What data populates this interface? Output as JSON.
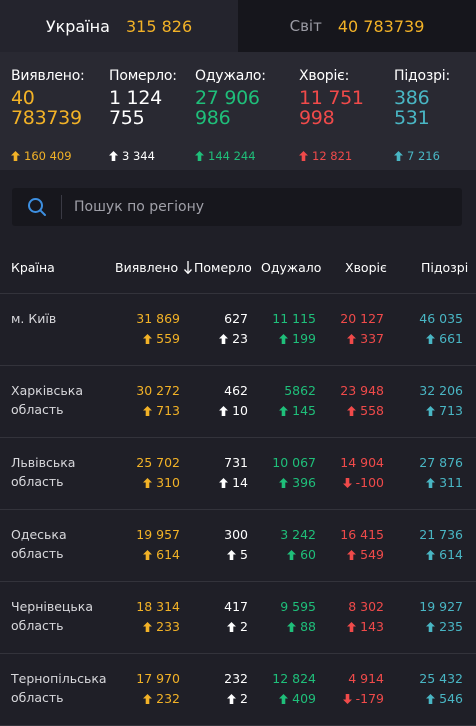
{
  "tabs": [
    {
      "name": "Україна",
      "value": "315 826"
    },
    {
      "name": "Світ",
      "value": "40 783739"
    }
  ],
  "summary": {
    "detected": {
      "label": "Виявлено:",
      "line1": "40",
      "line2": "783739",
      "delta": "160 409",
      "dir": "up",
      "color": "#f2b227"
    },
    "died": {
      "label": "Померло:",
      "line1": "1 124",
      "line2": "755",
      "delta": "3 344",
      "dir": "up",
      "color": "#ffffff"
    },
    "recovered": {
      "label": "Одужало:",
      "line1": "27 906",
      "line2": "986",
      "delta": "144 244",
      "dir": "up",
      "color": "#1fbf7a"
    },
    "sick": {
      "label": "Хворіє:",
      "line1": "11 751",
      "line2": "998",
      "delta": "12 821",
      "dir": "up",
      "color": "#f04a4a"
    },
    "suspected": {
      "label": "Підозрі:",
      "line1": "386",
      "line2": "531",
      "delta": "7 216",
      "dir": "up",
      "color": "#49b6c4"
    }
  },
  "search": {
    "placeholder": "Пошук по регіону"
  },
  "table": {
    "headers": {
      "country": "Країна",
      "detected": "Виявлено",
      "died": "Померло",
      "recovered": "Одужало",
      "sick": "Хворіє",
      "suspected": "Підозрі"
    },
    "rows": [
      {
        "name": "м. Київ",
        "detected": "31 869",
        "detected_d": "559",
        "detected_dir": "up",
        "died": "627",
        "died_d": "23",
        "died_dir": "up",
        "recovered": "11 115",
        "recovered_d": "199",
        "recovered_dir": "up",
        "sick": "20 127",
        "sick_d": "337",
        "sick_dir": "up",
        "suspected": "46 035",
        "suspected_d": "661",
        "suspected_dir": "up"
      },
      {
        "name": "Харківська область",
        "detected": "30 272",
        "detected_d": "713",
        "detected_dir": "up",
        "died": "462",
        "died_d": "10",
        "died_dir": "up",
        "recovered": "5862",
        "recovered_d": "145",
        "recovered_dir": "up",
        "sick": "23 948",
        "sick_d": "558",
        "sick_dir": "up",
        "suspected": "32 206",
        "suspected_d": "713",
        "suspected_dir": "up"
      },
      {
        "name": "Львівська область",
        "detected": "25 702",
        "detected_d": "310",
        "detected_dir": "up",
        "died": "731",
        "died_d": "14",
        "died_dir": "up",
        "recovered": "10 067",
        "recovered_d": "396",
        "recovered_dir": "up",
        "sick": "14 904",
        "sick_d": "-100",
        "sick_dir": "down",
        "suspected": "27 876",
        "suspected_d": "311",
        "suspected_dir": "up"
      },
      {
        "name": "Одеська область",
        "detected": "19 957",
        "detected_d": "614",
        "detected_dir": "up",
        "died": "300",
        "died_d": "5",
        "died_dir": "up",
        "recovered": "3 242",
        "recovered_d": "60",
        "recovered_dir": "up",
        "sick": "16 415",
        "sick_d": "549",
        "sick_dir": "up",
        "suspected": "21 736",
        "suspected_d": "614",
        "suspected_dir": "up"
      },
      {
        "name": "Чернівецька область",
        "detected": "18 314",
        "detected_d": "233",
        "detected_dir": "up",
        "died": "417",
        "died_d": "2",
        "died_dir": "up",
        "recovered": "9 595",
        "recovered_d": "88",
        "recovered_dir": "up",
        "sick": "8 302",
        "sick_d": "143",
        "sick_dir": "up",
        "suspected": "19 927",
        "suspected_d": "235",
        "suspected_dir": "up"
      },
      {
        "name": "Тернопільська область",
        "detected": "17 970",
        "detected_d": "232",
        "detected_dir": "up",
        "died": "232",
        "died_d": "2",
        "died_dir": "up",
        "recovered": "12 824",
        "recovered_d": "409",
        "recovered_dir": "up",
        "sick": "4 914",
        "sick_d": "-179",
        "sick_dir": "down",
        "suspected": "25 432",
        "suspected_d": "546",
        "suspected_dir": "up"
      }
    ]
  }
}
